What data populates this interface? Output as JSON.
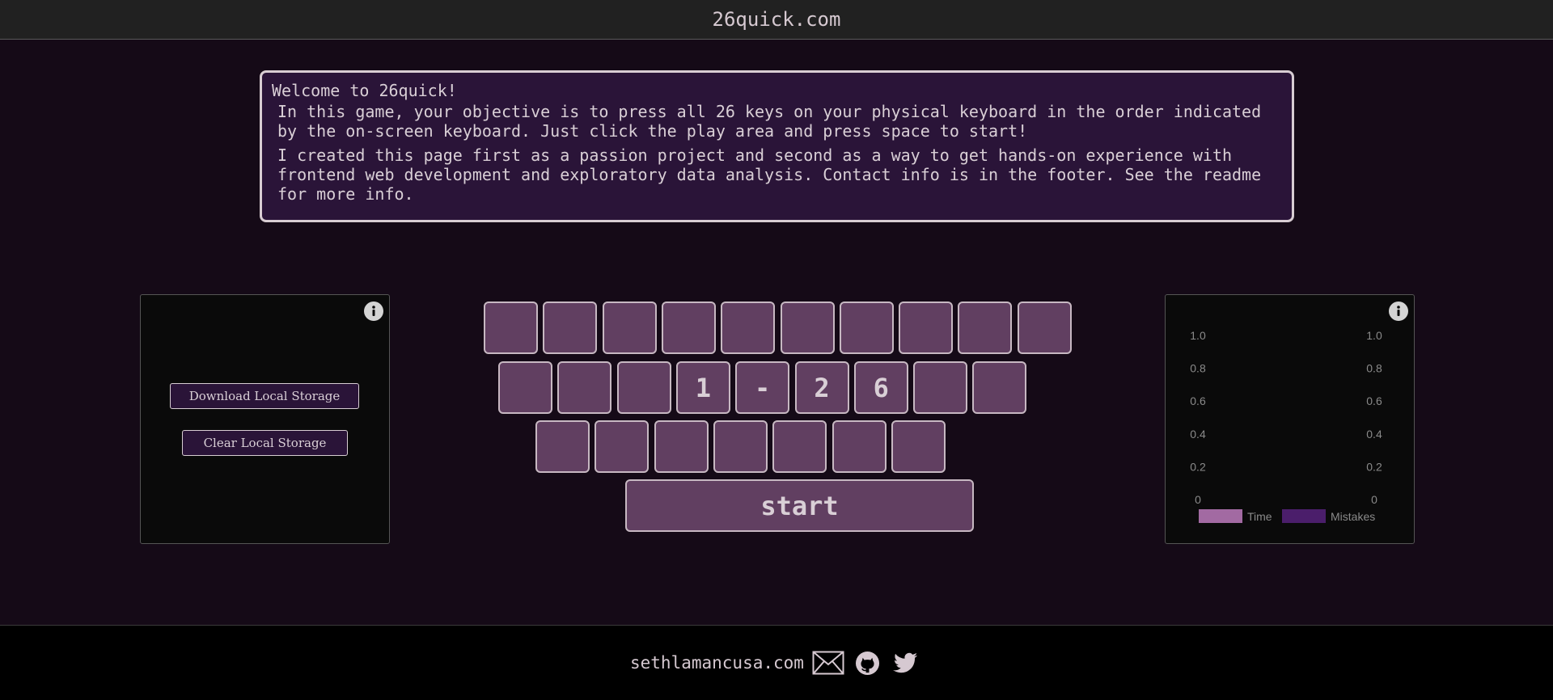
{
  "header": {
    "title": "26quick.com"
  },
  "welcome": {
    "title": "Welcome to 26quick!",
    "paragraph1": "In this game, your objective is to press all 26 keys on your physical keyboard in the order indicated by the on-screen keyboard. Just click the play area and press space to start!",
    "paragraph2": "I created this page first as a passion project and second as a way to get hands-on experience with frontend web development and exploratory data analysis. Contact info is in the footer. See the readme for more info."
  },
  "storage": {
    "download_label": "Download Local Storage",
    "clear_label": "Clear Local Storage",
    "info_icon": "info-icon"
  },
  "keyboard": {
    "rows": [
      [
        "",
        "",
        "",
        "",
        "",
        "",
        "",
        "",
        "",
        ""
      ],
      [
        "",
        "",
        "",
        "1",
        "-",
        "2",
        "6",
        "",
        ""
      ],
      [
        "",
        "",
        "",
        "",
        "",
        "",
        ""
      ]
    ],
    "start_label": "start"
  },
  "chart_data": {
    "type": "bar",
    "categories": [],
    "series": [
      {
        "name": "Time",
        "values": [],
        "color": "#a26aa2"
      },
      {
        "name": "Mistakes",
        "values": [],
        "color": "#4b1e6b"
      }
    ],
    "yticks_left": [
      "1.0",
      "0.8",
      "0.6",
      "0.4",
      "0.2",
      "0"
    ],
    "yticks_right": [
      "1.0",
      "0.8",
      "0.6",
      "0.4",
      "0.2",
      "0"
    ],
    "ylim": [
      0,
      1
    ],
    "grid": false,
    "legend_position": "bottom"
  },
  "footer": {
    "link_text": "sethlamancusa.com",
    "icons": [
      "mail-icon",
      "github-icon",
      "twitter-icon"
    ]
  },
  "colors": {
    "background": "#150a17",
    "key_fill": "#613f61",
    "panel_accent": "#2a1438"
  }
}
